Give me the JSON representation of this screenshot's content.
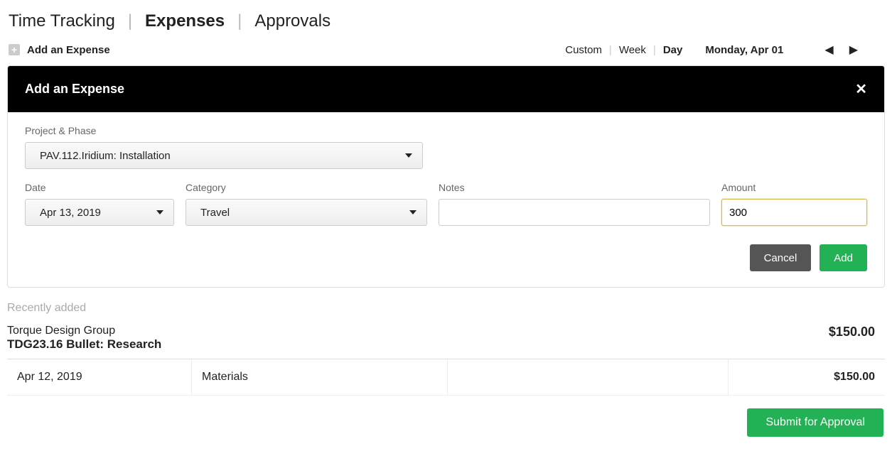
{
  "topTabs": {
    "timeTracking": "Time Tracking",
    "expenses": "Expenses",
    "approvals": "Approvals"
  },
  "toolbar": {
    "addExpense": "Add an Expense",
    "ranges": {
      "custom": "Custom",
      "week": "Week",
      "day": "Day"
    },
    "dateLabel": "Monday, Apr 01"
  },
  "modal": {
    "title": "Add an Expense",
    "fields": {
      "projectLabel": "Project & Phase",
      "projectValue": "PAV.112.Iridium: Installation",
      "dateLabel": "Date",
      "dateValue": "Apr 13, 2019",
      "categoryLabel": "Category",
      "categoryValue": "Travel",
      "notesLabel": "Notes",
      "notesValue": "",
      "amountLabel": "Amount",
      "amountValue": "300"
    },
    "buttons": {
      "cancel": "Cancel",
      "add": "Add"
    }
  },
  "recent": {
    "sectionTitle": "Recently added",
    "company": "Torque Design Group",
    "project": "TDG23.16 Bullet: Research",
    "total": "$150.00",
    "rows": [
      {
        "date": "Apr 12, 2019",
        "category": "Materials",
        "amount": "$150.00"
      }
    ]
  },
  "submit": {
    "label": "Submit for Approval"
  }
}
